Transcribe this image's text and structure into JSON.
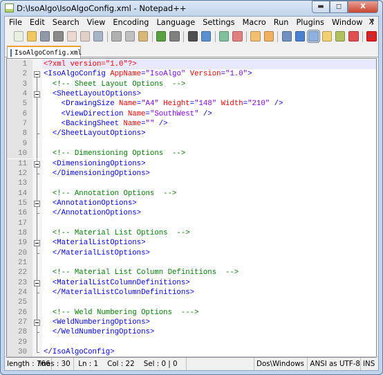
{
  "window": {
    "title": "D:\\IsoAlgo\\IsoAlgoConfig.xml - Notepad++",
    "min": "▬",
    "max": "◻",
    "close": "X"
  },
  "menu": {
    "items": [
      "File",
      "Edit",
      "Search",
      "View",
      "Encoding",
      "Language",
      "Settings",
      "Macro",
      "Run",
      "Plugins",
      "Window",
      "?"
    ],
    "close": "X"
  },
  "toolbar": {
    "icons": [
      {
        "name": "new-file",
        "color": "#e8f0e0"
      },
      {
        "name": "open-file",
        "color": "#f0c860"
      },
      {
        "name": "save",
        "color": "#909aa6"
      },
      {
        "name": "save-all",
        "color": "#8a8a8a"
      },
      {
        "name": "close",
        "color": "#e8d8d0"
      },
      {
        "name": "close-all",
        "color": "#e0d0c8"
      },
      {
        "name": "print",
        "color": "#a8b4c8"
      },
      "sep",
      {
        "name": "cut",
        "color": "#b0b0b0"
      },
      {
        "name": "copy",
        "color": "#c0c0c0"
      },
      {
        "name": "paste",
        "color": "#d8b878"
      },
      "sep",
      {
        "name": "undo",
        "color": "#5aa040"
      },
      {
        "name": "redo",
        "color": "#808080"
      },
      "sep",
      {
        "name": "find",
        "color": "#505050"
      },
      {
        "name": "replace",
        "color": "#5a90d0"
      },
      "sep",
      {
        "name": "zoom-in",
        "color": "#80c0a0"
      },
      {
        "name": "zoom-out",
        "color": "#e08080"
      },
      "sep",
      {
        "name": "sync-vertical",
        "color": "#f0c070"
      },
      {
        "name": "sync-horizontal",
        "color": "#f0b060"
      },
      "sep",
      {
        "name": "word-wrap",
        "color": "#7090c0"
      },
      {
        "name": "show-all-chars",
        "color": "#4a80d0"
      },
      {
        "name": "indent-guide",
        "color": "#90b0e0",
        "pressed": true
      },
      {
        "name": "user-language",
        "color": "#f0d070"
      },
      {
        "name": "function-list",
        "color": "#b0c060"
      },
      {
        "name": "pdf",
        "color": "#e05050"
      },
      "sep",
      {
        "name": "record-macro",
        "color": "#e02020"
      }
    ],
    "overflow": "»"
  },
  "tab": {
    "label": "IsoAlgoConfig.xml"
  },
  "editor": {
    "current_line": 1,
    "lines": [
      {
        "fold": "none",
        "t": [
          [
            "decl",
            "<?xml "
          ],
          [
            "attr",
            "version"
          ],
          [
            "decl",
            "=\"1.0\"?>"
          ]
        ]
      },
      {
        "fold": "open",
        "t": [
          [
            "tag",
            "<IsoAlgoConfig "
          ],
          [
            "attr",
            "AppName"
          ],
          [
            "tag",
            "="
          ],
          [
            "val",
            "\"IsoAlgo\""
          ],
          [
            "tag",
            " "
          ],
          [
            "attr",
            "Version"
          ],
          [
            "tag",
            "="
          ],
          [
            "val",
            "\"1.0\""
          ],
          [
            "tag",
            ">"
          ]
        ]
      },
      {
        "fold": "line",
        "t": [
          [
            "txt",
            "  "
          ],
          [
            "com",
            "<!-- Sheet Layout Options  -->"
          ]
        ]
      },
      {
        "fold": "open",
        "t": [
          [
            "txt",
            "  "
          ],
          [
            "tag",
            "<SheetLayoutOptions>"
          ]
        ]
      },
      {
        "fold": "line",
        "t": [
          [
            "txt",
            "    "
          ],
          [
            "tag",
            "<DrawingSize "
          ],
          [
            "attr",
            "Name"
          ],
          [
            "tag",
            "="
          ],
          [
            "val",
            "\"A4\""
          ],
          [
            "tag",
            " "
          ],
          [
            "attr",
            "Height"
          ],
          [
            "tag",
            "="
          ],
          [
            "val",
            "\"148\""
          ],
          [
            "tag",
            " "
          ],
          [
            "attr",
            "Width"
          ],
          [
            "tag",
            "="
          ],
          [
            "val",
            "\"210\""
          ],
          [
            "tag",
            " />"
          ]
        ]
      },
      {
        "fold": "line",
        "t": [
          [
            "txt",
            "    "
          ],
          [
            "tag",
            "<ViewDirection "
          ],
          [
            "attr",
            "Name"
          ],
          [
            "tag",
            "="
          ],
          [
            "val",
            "\"SouthWest\""
          ],
          [
            "tag",
            " />"
          ]
        ]
      },
      {
        "fold": "line",
        "t": [
          [
            "txt",
            "    "
          ],
          [
            "tag",
            "<BackingSheet "
          ],
          [
            "attr",
            "Name"
          ],
          [
            "tag",
            "="
          ],
          [
            "val",
            "\"\""
          ],
          [
            "tag",
            " />"
          ]
        ]
      },
      {
        "fold": "end",
        "t": [
          [
            "txt",
            "  "
          ],
          [
            "tag",
            "</SheetLayoutOptions>"
          ]
        ]
      },
      {
        "fold": "line",
        "t": []
      },
      {
        "fold": "line",
        "t": [
          [
            "txt",
            "  "
          ],
          [
            "com",
            "<!-- Dimensioning Options  -->"
          ]
        ]
      },
      {
        "fold": "open",
        "t": [
          [
            "txt",
            "  "
          ],
          [
            "tag",
            "<DimensioningOptions>"
          ]
        ]
      },
      {
        "fold": "end",
        "t": [
          [
            "txt",
            "  "
          ],
          [
            "tag",
            "</DimensioningOptions>"
          ]
        ]
      },
      {
        "fold": "line",
        "t": []
      },
      {
        "fold": "line",
        "t": [
          [
            "txt",
            "  "
          ],
          [
            "com",
            "<!-- Annotation Options  -->"
          ]
        ]
      },
      {
        "fold": "open",
        "t": [
          [
            "txt",
            "  "
          ],
          [
            "tag",
            "<AnnotationOptions>"
          ]
        ]
      },
      {
        "fold": "end",
        "t": [
          [
            "txt",
            "  "
          ],
          [
            "tag",
            "</AnnotationOptions>"
          ]
        ]
      },
      {
        "fold": "line",
        "t": []
      },
      {
        "fold": "line",
        "t": [
          [
            "txt",
            "  "
          ],
          [
            "com",
            "<!-- Material List Options  -->"
          ]
        ]
      },
      {
        "fold": "open",
        "t": [
          [
            "txt",
            "  "
          ],
          [
            "tag",
            "<MaterialListOptions>"
          ]
        ]
      },
      {
        "fold": "end",
        "t": [
          [
            "txt",
            "  "
          ],
          [
            "tag",
            "</MaterialListOptions>"
          ]
        ]
      },
      {
        "fold": "line",
        "t": []
      },
      {
        "fold": "line",
        "t": [
          [
            "txt",
            "  "
          ],
          [
            "com",
            "<!-- Material List Column Definitions  -->"
          ]
        ]
      },
      {
        "fold": "open",
        "t": [
          [
            "txt",
            "  "
          ],
          [
            "tag",
            "<MaterialListColumnDefinitions>"
          ]
        ]
      },
      {
        "fold": "end",
        "t": [
          [
            "txt",
            "  "
          ],
          [
            "tag",
            "</MaterialListColumnDefinitions>"
          ]
        ]
      },
      {
        "fold": "line",
        "t": []
      },
      {
        "fold": "line",
        "t": [
          [
            "txt",
            "  "
          ],
          [
            "com",
            "<!-- Weld Numbering Options  --->"
          ]
        ]
      },
      {
        "fold": "open",
        "t": [
          [
            "txt",
            "  "
          ],
          [
            "tag",
            "<WeldNumberingOptions>"
          ]
        ]
      },
      {
        "fold": "end",
        "t": [
          [
            "txt",
            "  "
          ],
          [
            "tag",
            "</WeldNumberingOptions>"
          ]
        ]
      },
      {
        "fold": "line",
        "t": []
      },
      {
        "fold": "last",
        "t": [
          [
            "tag",
            "</IsoAlgoConfig>"
          ]
        ]
      }
    ]
  },
  "status": {
    "length": "length : 766",
    "lines": "lines : 30",
    "position": "Ln : 1    Col : 22    Sel : 0 | 0",
    "eol": "Dos\\Windows",
    "encoding": "ANSI as UTF-8",
    "mode": "INS"
  }
}
